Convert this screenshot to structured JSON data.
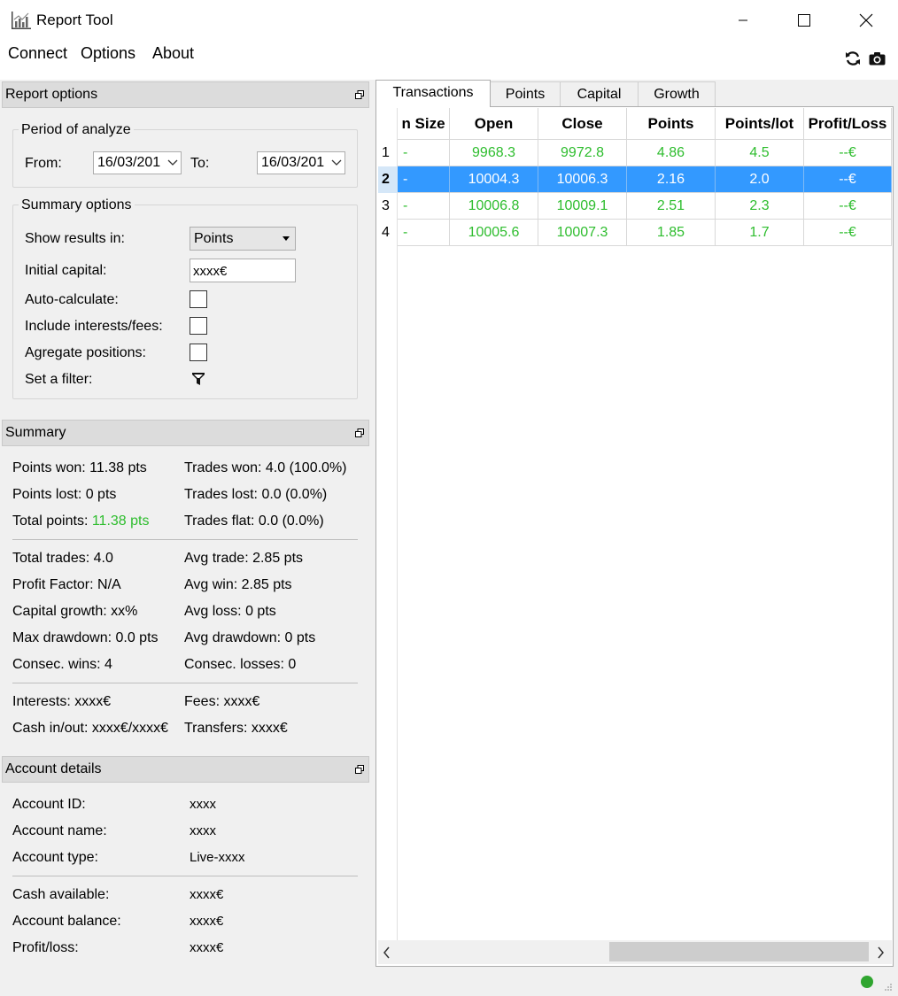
{
  "window": {
    "title": "Report Tool"
  },
  "menu": {
    "items": [
      "Connect",
      "Options",
      "About"
    ]
  },
  "report_options": {
    "header": "Report options",
    "period_group": "Period of analyze",
    "from_label": "From:",
    "from_value": "16/03/201",
    "to_label": "To:",
    "to_value": "16/03/201",
    "summary_group": "Summary options",
    "show_results_label": "Show results in:",
    "show_results_value": "Points",
    "initial_capital_label": "Initial capital:",
    "initial_capital_value": "xxxx€",
    "auto_calc_label": "Auto-calculate:",
    "include_fees_label": "Include interests/fees:",
    "aggregate_label": "Agregate positions:",
    "filter_label": "Set a filter:"
  },
  "summary": {
    "header": "Summary",
    "points_won": "Points won: 11.38 pts",
    "trades_won": "Trades won: 4.0 (100.0%)",
    "points_lost": "Points lost: 0 pts",
    "trades_lost": "Trades lost: 0.0 (0.0%)",
    "total_points_label": "Total points:",
    "total_points_value": "11.38 pts",
    "trades_flat": "Trades flat: 0.0 (0.0%)",
    "total_trades": "Total trades: 4.0",
    "avg_trade": "Avg trade: 2.85 pts",
    "profit_factor": "Profit Factor: N/A",
    "avg_win": "Avg win: 2.85 pts",
    "capital_growth": "Capital growth: xx%",
    "avg_loss": "Avg loss: 0 pts",
    "max_drawdown": "Max drawdown: 0.0 pts",
    "avg_drawdown": "Avg drawdown: 0 pts",
    "consec_wins": "Consec. wins: 4",
    "consec_losses": "Consec. losses: 0",
    "interests": "Interests: xxxx€",
    "fees": "Fees: xxxx€",
    "cash_inout": "Cash in/out: xxxx€/xxxx€",
    "transfers": "Transfers: xxxx€"
  },
  "account": {
    "header": "Account details",
    "id_label": "Account ID:",
    "id_value": "xxxx",
    "name_label": "Account name:",
    "name_value": "xxxx",
    "type_label": "Account type:",
    "type_value": "Live-xxxx",
    "cash_label": "Cash available:",
    "cash_value": "xxxx€",
    "balance_label": "Account balance:",
    "balance_value": "xxxx€",
    "pl_label": "Profit/loss:",
    "pl_value": "xxxx€"
  },
  "tabs": [
    "Transactions",
    "Points",
    "Capital",
    "Growth"
  ],
  "table": {
    "columns": [
      "n Size",
      "Open",
      "Close",
      "Points",
      "Points/lot",
      "Profit/Loss"
    ],
    "rows": [
      {
        "num": "1",
        "size": "-",
        "open": "9968.3",
        "close": "9972.8",
        "points": "4.86",
        "points_lot": "4.5",
        "pl": "--€"
      },
      {
        "num": "2",
        "size": "-",
        "open": "10004.3",
        "close": "10006.3",
        "points": "2.16",
        "points_lot": "2.0",
        "pl": "--€"
      },
      {
        "num": "3",
        "size": "-",
        "open": "10006.8",
        "close": "10009.1",
        "points": "2.51",
        "points_lot": "2.3",
        "pl": "--€"
      },
      {
        "num": "4",
        "size": "-",
        "open": "10005.6",
        "close": "10007.3",
        "points": "1.85",
        "points_lot": "1.7",
        "pl": "--€"
      }
    ],
    "selected_row": 1
  },
  "colors": {
    "positive": "#2ebd2e",
    "selection": "#3399ff",
    "status_ok": "#2fa52f"
  }
}
